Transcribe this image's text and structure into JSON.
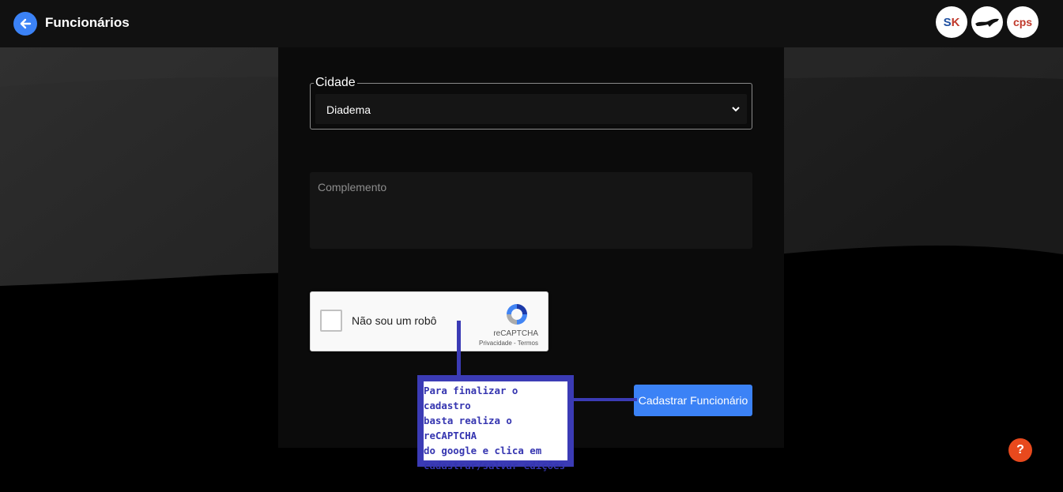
{
  "header": {
    "title": "Funcionários",
    "back_icon": "arrow-left-icon",
    "logos": [
      "SK",
      "horse",
      "cps"
    ]
  },
  "form": {
    "cidade": {
      "label": "Cidade",
      "value": "Diadema"
    },
    "complemento": {
      "placeholder": "Complemento"
    },
    "recaptcha": {
      "label": "Não sou um robô",
      "brand": "reCAPTCHA",
      "links": "Privacidade - Termos"
    },
    "submit_label": "Cadastrar Funcionário"
  },
  "annotation": {
    "lines": [
      "Para finalizar o cadastro",
      "basta realiza o reCAPTCHA",
      "do google e clica em",
      "cadastrar/salvar edições"
    ]
  },
  "help": {
    "label": "?"
  },
  "colors": {
    "accent": "#3b82f6",
    "annotation": "#3b3bb5",
    "help": "#e8491d"
  }
}
